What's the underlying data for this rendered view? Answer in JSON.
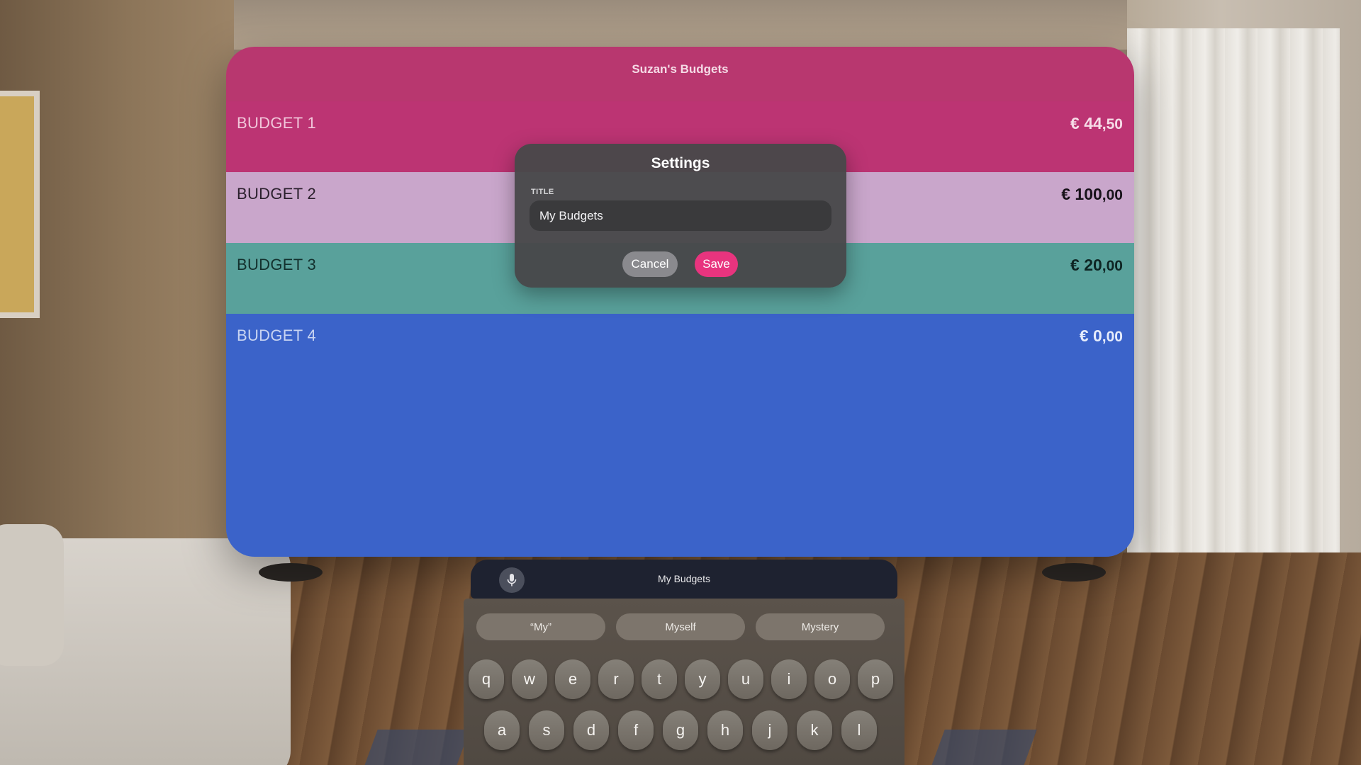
{
  "app": {
    "window_title": "Suzan's Budgets"
  },
  "budgets": [
    {
      "name": "BUDGET 1",
      "amount_main": "€ 44",
      "amount_cents": ",50",
      "color": "#bc3473"
    },
    {
      "name": "BUDGET 2",
      "amount_main": "€ 100",
      "amount_cents": ",00",
      "color": "#c9a6cb"
    },
    {
      "name": "BUDGET 3",
      "amount_main": "€ 20",
      "amount_cents": ",00",
      "color": "#59a19b"
    },
    {
      "name": "BUDGET 4",
      "amount_main": "€ 0",
      "amount_cents": ",00",
      "color": "#3b63c9"
    }
  ],
  "settings_dialog": {
    "title": "Settings",
    "field_label": "TITLE",
    "title_value": "My Budgets",
    "cancel_label": "Cancel",
    "save_label": "Save",
    "save_color": "#e8347e"
  },
  "keyboard": {
    "mic_icon": "microphone-icon",
    "preview_text": "My Budgets",
    "suggestions": [
      "“My”",
      "Myself",
      "Mystery"
    ],
    "row1": [
      "q",
      "w",
      "e",
      "r",
      "t",
      "y",
      "u",
      "i",
      "o",
      "p"
    ],
    "row2": [
      "a",
      "s",
      "d",
      "f",
      "g",
      "h",
      "j",
      "k",
      "l"
    ]
  },
  "colors": {
    "header": "#b8376f",
    "accent": "#e8347e"
  }
}
